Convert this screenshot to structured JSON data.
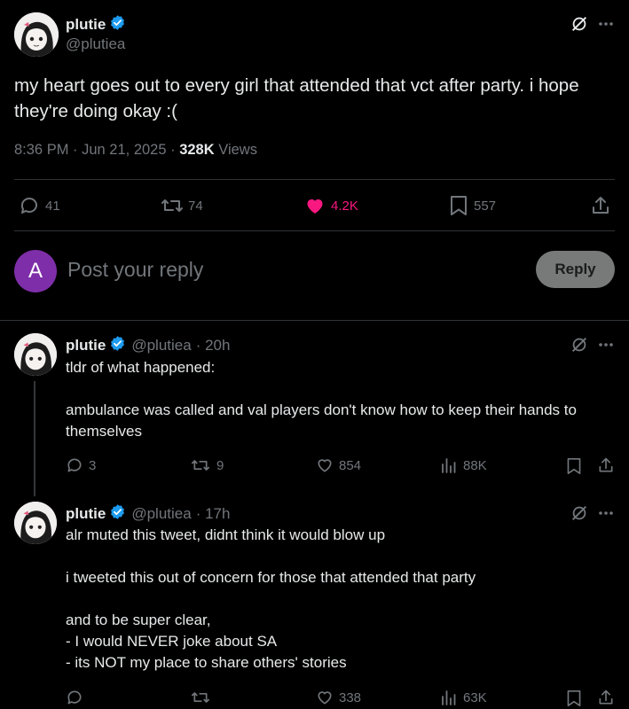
{
  "main_tweet": {
    "name": "plutie",
    "handle": "@plutiea",
    "text": "my heart goes out to every girl that attended that vct after party. i hope they're doing okay :(",
    "time": "8:36 PM · Jun 21, 2025 · ",
    "views_count": "328K",
    "views_label": " Views",
    "replies": "41",
    "reposts": "74",
    "likes": "4.2K",
    "bookmarks": "557",
    "like_color": "#f91880"
  },
  "reply_composer": {
    "avatar_letter": "A",
    "placeholder": "Post your reply",
    "button_label": "Reply"
  },
  "thread": [
    {
      "name": "plutie",
      "handle": "@plutiea",
      "time": "· 20h",
      "text": "tldr of what happened:\n\nambulance was called and val players don't know how to keep their hands to themselves",
      "replies": "3",
      "reposts": "9",
      "likes": "854",
      "views": "88K"
    },
    {
      "name": "plutie",
      "handle": "@plutiea",
      "time": "· 17h",
      "text": "alr muted this tweet, didnt think it would blow up\n\ni tweeted this out of concern for those that attended that party\n\nand to be super clear,\n- I would NEVER joke about SA\n- its NOT my place to share others' stories",
      "replies": "",
      "reposts": "",
      "likes": "338",
      "views": "63K"
    }
  ]
}
